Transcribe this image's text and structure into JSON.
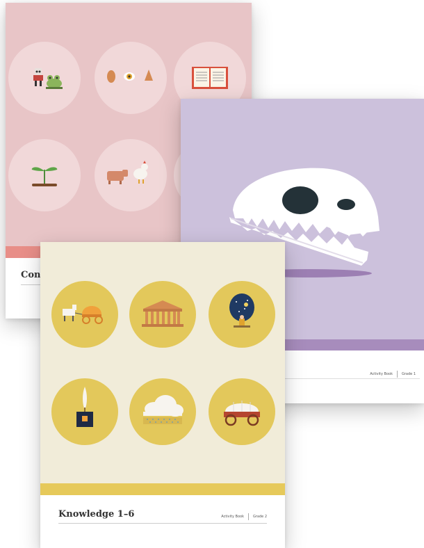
{
  "books": {
    "pink": {
      "title": "Con",
      "colors": {
        "cover": "#e8c5c7",
        "circle": "#f1d8d9",
        "stripe": "#e88e88"
      },
      "icons": [
        "robot-icon",
        "frog-icon",
        "ear-icon",
        "eye-icon",
        "nose-icon",
        "open-book-icon",
        "sprout-icon",
        "pig-icon",
        "chicken-icon"
      ]
    },
    "purple": {
      "meta_product": "Activity Book",
      "meta_grade": "Grade 1",
      "colors": {
        "cover": "#ccc1dc",
        "stripe": "#a78cbc"
      },
      "icons": [
        "dinosaur-skull-icon"
      ]
    },
    "yellow": {
      "title": "Knowledge 1–6",
      "meta_product": "Activity Book",
      "meta_grade": "Grade 2",
      "colors": {
        "cover": "#f1ecd9",
        "circle": "#e3c85b",
        "stripe": "#e6c95a"
      },
      "icons": [
        "horse-carriage-icon",
        "greek-temple-icon",
        "astronomer-icon",
        "quill-inkwell-icon",
        "cloud-field-icon",
        "covered-wagon-icon"
      ]
    }
  }
}
